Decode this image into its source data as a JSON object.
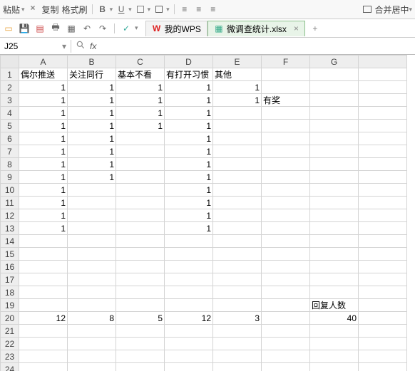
{
  "topbar": {
    "paste_label": "粘贴",
    "copy_label": "复制",
    "fmtpaint_label": "格式刷",
    "merge_label": "合并居中"
  },
  "tabs": {
    "wps_label": "我的WPS",
    "doc_label": "微调查统计.xlsx",
    "close": "×",
    "plus": "+"
  },
  "formula": {
    "cellref": "J25",
    "fx": "fx"
  },
  "columns": [
    "A",
    "B",
    "C",
    "D",
    "E",
    "F",
    "G"
  ],
  "headers": {
    "A": "偶尔推送",
    "B": "关注同行",
    "C": "基本不看",
    "D": "有打开习惯",
    "E": "其他",
    "F_row3": "有奖",
    "G_row19": "回复人数"
  },
  "sums": {
    "A": 12,
    "B": 8,
    "C": 5,
    "D": 12,
    "E": 3,
    "G": 40
  },
  "cells": {
    "r2": {
      "A": 1,
      "B": 1,
      "C": 1,
      "D": 1,
      "E": 1
    },
    "r3": {
      "A": 1,
      "B": 1,
      "C": 1,
      "D": 1,
      "E": 1
    },
    "r4": {
      "A": 1,
      "B": 1,
      "C": 1,
      "D": 1
    },
    "r5": {
      "A": 1,
      "B": 1,
      "C": 1,
      "D": 1
    },
    "r6": {
      "A": 1,
      "B": 1,
      "D": 1
    },
    "r7": {
      "A": 1,
      "B": 1,
      "D": 1
    },
    "r8": {
      "A": 1,
      "B": 1,
      "D": 1
    },
    "r9": {
      "A": 1,
      "B": 1,
      "D": 1
    },
    "r10": {
      "A": 1,
      "D": 1
    },
    "r11": {
      "A": 1,
      "D": 1
    },
    "r12": {
      "A": 1,
      "D": 1
    },
    "r13": {
      "A": 1,
      "D": 1
    }
  },
  "rowcount": 24
}
